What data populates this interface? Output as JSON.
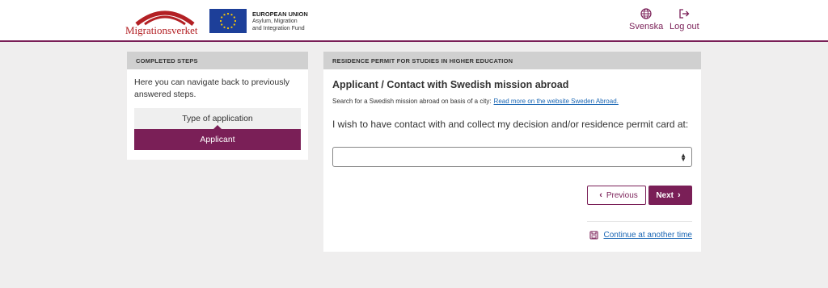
{
  "header": {
    "logo_text": "Migrationsverket",
    "eu": {
      "line1": "EUROPEAN UNION",
      "line2": "Asylum, Migration",
      "line3": "and Integration Fund"
    },
    "language_label": "Svenska",
    "logout_label": "Log out",
    "colors": {
      "brand": "#7a1f57",
      "logo_red": "#b32024",
      "eu_blue": "#1d3f99",
      "eu_star": "#ffcc00"
    }
  },
  "completed_steps": {
    "heading": "COMPLETED STEPS",
    "description": "Here you can navigate back to previously answered steps.",
    "steps": [
      {
        "label": "Type of application",
        "active": false
      },
      {
        "label": "Applicant",
        "active": true
      }
    ]
  },
  "main": {
    "heading": "RESIDENCE PERMIT FOR STUDIES IN HIGHER EDUCATION",
    "title": "Applicant / Contact with Swedish mission abroad",
    "search_text": "Search for a Swedish mission abroad on basis of a city:",
    "search_link": "Read more on the website Sweden Abroad.",
    "question": "I wish to have contact with and collect my decision and/or residence permit card at:",
    "select_value": "",
    "previous_label": "Previous",
    "next_label": "Next",
    "continue_label": "Continue at another time"
  }
}
